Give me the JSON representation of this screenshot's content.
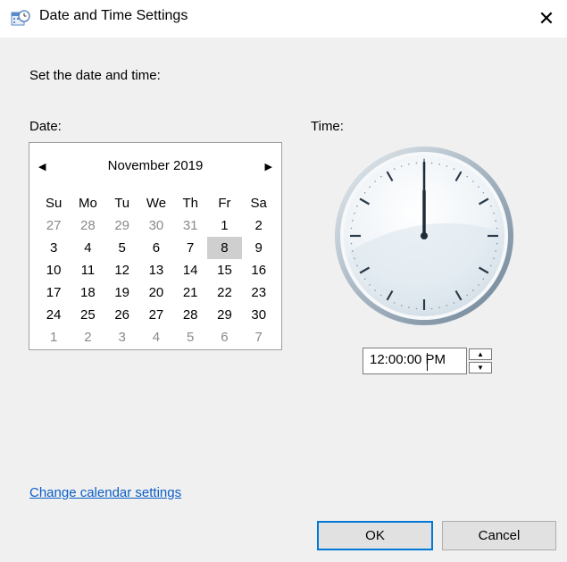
{
  "window": {
    "title": "Date and Time Settings",
    "close_glyph": "✕",
    "icon": "clock-calendar-icon"
  },
  "instruction": "Set the date and time:",
  "date_label": "Date:",
  "time_label": "Time:",
  "calendar": {
    "month_title": "November 2019",
    "prev_glyph": "◀",
    "next_glyph": "▶",
    "weekdays": [
      "Su",
      "Mo",
      "Tu",
      "We",
      "Th",
      "Fr",
      "Sa"
    ],
    "weeks": [
      [
        {
          "d": "27",
          "cur": false
        },
        {
          "d": "28",
          "cur": false
        },
        {
          "d": "29",
          "cur": false
        },
        {
          "d": "30",
          "cur": false
        },
        {
          "d": "31",
          "cur": false
        },
        {
          "d": "1",
          "cur": true
        },
        {
          "d": "2",
          "cur": true
        }
      ],
      [
        {
          "d": "3",
          "cur": true
        },
        {
          "d": "4",
          "cur": true
        },
        {
          "d": "5",
          "cur": true
        },
        {
          "d": "6",
          "cur": true
        },
        {
          "d": "7",
          "cur": true
        },
        {
          "d": "8",
          "cur": true,
          "selected": true
        },
        {
          "d": "9",
          "cur": true
        }
      ],
      [
        {
          "d": "10",
          "cur": true
        },
        {
          "d": "11",
          "cur": true
        },
        {
          "d": "12",
          "cur": true
        },
        {
          "d": "13",
          "cur": true
        },
        {
          "d": "14",
          "cur": true
        },
        {
          "d": "15",
          "cur": true
        },
        {
          "d": "16",
          "cur": true
        }
      ],
      [
        {
          "d": "17",
          "cur": true
        },
        {
          "d": "18",
          "cur": true
        },
        {
          "d": "19",
          "cur": true
        },
        {
          "d": "20",
          "cur": true
        },
        {
          "d": "21",
          "cur": true
        },
        {
          "d": "22",
          "cur": true
        },
        {
          "d": "23",
          "cur": true
        }
      ],
      [
        {
          "d": "24",
          "cur": true
        },
        {
          "d": "25",
          "cur": true
        },
        {
          "d": "26",
          "cur": true
        },
        {
          "d": "27",
          "cur": true
        },
        {
          "d": "28",
          "cur": true
        },
        {
          "d": "29",
          "cur": true
        },
        {
          "d": "30",
          "cur": true
        }
      ],
      [
        {
          "d": "1",
          "cur": false
        },
        {
          "d": "2",
          "cur": false
        },
        {
          "d": "3",
          "cur": false
        },
        {
          "d": "4",
          "cur": false
        },
        {
          "d": "5",
          "cur": false
        },
        {
          "d": "6",
          "cur": false
        },
        {
          "d": "7",
          "cur": false
        }
      ]
    ]
  },
  "clock": {
    "hour": 12,
    "minute": 0,
    "second": 0
  },
  "time_field": {
    "value": "12:00:00 PM"
  },
  "link_text": "Change calendar settings",
  "buttons": {
    "ok": "OK",
    "cancel": "Cancel"
  },
  "colors": {
    "link": "#0b5ec7",
    "accent": "#0078d7",
    "selected_day_bg": "#cfcfcf"
  }
}
